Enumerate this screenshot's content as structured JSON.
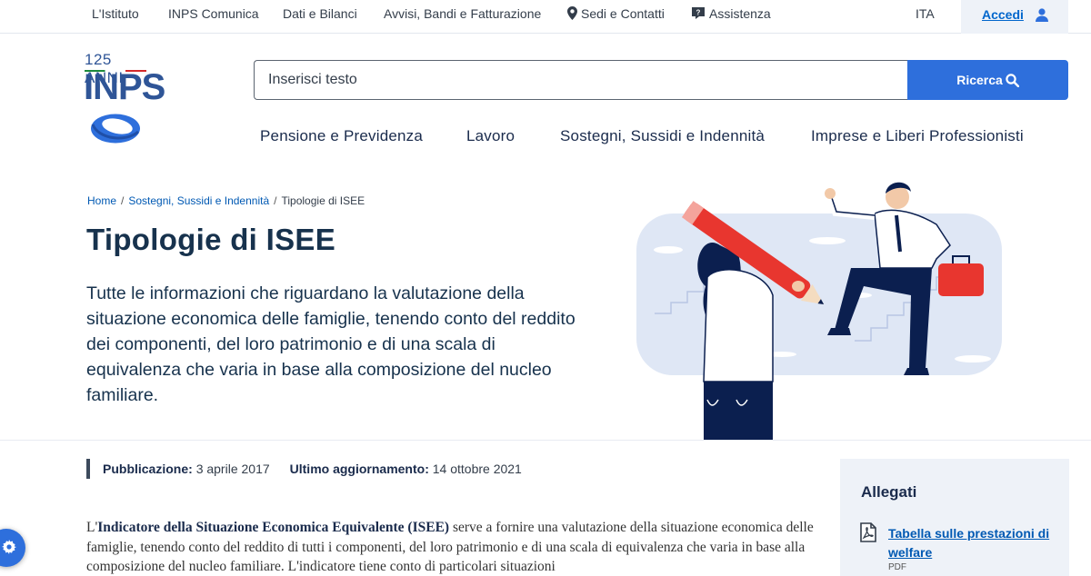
{
  "topbar": {
    "links": [
      "L'Istituto",
      "INPS Comunica",
      "Dati e Bilanci",
      "Avvisi, Bandi e Fatturazione",
      "Sedi e Contatti",
      "Assistenza"
    ],
    "language": "ITA",
    "login_label": "Accedi"
  },
  "logo": {
    "anniversary": "125 ANNI",
    "brand": "INPS"
  },
  "search": {
    "placeholder": "Inserisci testo",
    "button_label": "Ricerca"
  },
  "main_nav": [
    "Pensione e Previdenza",
    "Lavoro",
    "Sostegni, Sussidi e Indennità",
    "Imprese e Liberi Professionisti"
  ],
  "breadcrumb": [
    "Home",
    "Sostegni, Sussidi e Indennità",
    "Tipologie di ISEE"
  ],
  "page": {
    "title": "Tipologie di ISEE",
    "lead": "Tutte le informazioni che riguardano la valutazione della situazione economica delle famiglie, tenendo conto del reddito dei componenti, del loro patrimonio e di una scala di equivalenza che varia in base alla composizione del nucleo familiare."
  },
  "meta": {
    "published_label": "Pubblicazione:",
    "published_value": "3 aprile 2017",
    "updated_label": "Ultimo aggiornamento:",
    "updated_value": "14 ottobre 2021"
  },
  "body": {
    "intro_prefix": "L'",
    "intro_bold": "Indicatore della Situazione Economica Equivalente (ISEE)",
    "intro_rest": " serve a fornire una valutazione della situazione economica delle famiglie, tenendo conto del reddito di tutti i componenti, del loro patrimonio e di una scala di equivalenza che varia in base alla composizione del nucleo familiare. L'indicatore tiene conto di particolari situazioni"
  },
  "attachments": {
    "heading": "Allegati",
    "items": [
      {
        "label": "Tabella sulle prestazioni di welfare",
        "format": "PDF"
      }
    ]
  },
  "colors": {
    "primary": "#2e6fdc",
    "navy": "#17324d",
    "link": "#0059b3",
    "panel": "#eef2f8"
  }
}
